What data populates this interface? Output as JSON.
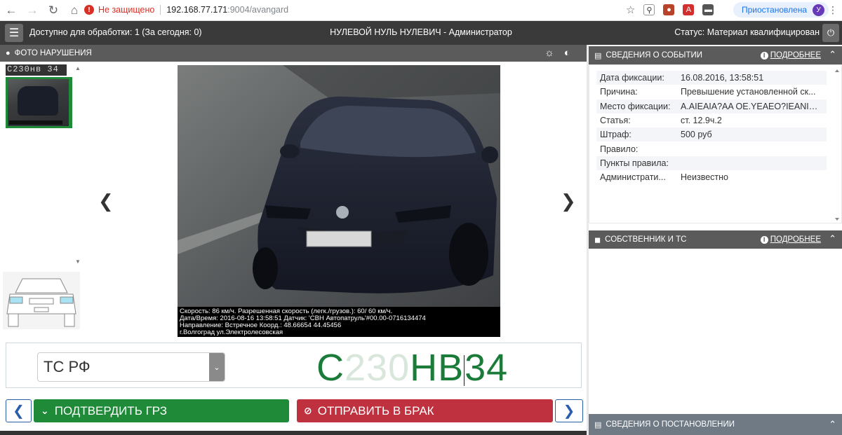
{
  "browser": {
    "insecure_label": "Не защищено",
    "url_host": "192.168.77.171",
    "url_path": ":9004/avangard",
    "profile_status": "Приостановлена",
    "profile_initial": "У"
  },
  "header": {
    "available": "Доступно для обработки: 1 (За сегодня: 0)",
    "user": "НУЛЕВОЙ НУЛЬ НУЛЕВИЧ - Администратор",
    "status": "Статус: Материал квалифицирован"
  },
  "photo_panel": {
    "title": "Фото нарушения",
    "thumb_plate": "С230нв 34",
    "info_lines": [
      "Скорость:  86 км/ч. Разрешенная скорость (легк./грузов.):  60/ 60 км/ч.",
      "Дата/Время: 2016-08-16 13:58:51 Датчик: 'СВН Автопатруль'#00.00-0716134474",
      "Направление: Встречное Коорд.: 48.66654 44.45456",
      "г.Волгоград ул.Электролесовская"
    ],
    "plate_on_car": "С230нв 34"
  },
  "plate_input": {
    "country": "ТС РФ",
    "plate_prefix": "С",
    "plate_hidden": "230",
    "plate_mid": "НВ",
    "plate_region": "34"
  },
  "actions": {
    "confirm": "Подтвердить ГРЗ",
    "reject": "Отправить в брак"
  },
  "event_panel": {
    "title": "Сведения о событии",
    "more": "Подробнее",
    "rows": [
      {
        "k": "Дата фиксации:",
        "v": "16.08.2016, 13:58:51"
      },
      {
        "k": "Причина:",
        "v": "Превышение установленной ск..."
      },
      {
        "k": "Место фиксации:",
        "v": "А.AIEAIA?AA OE.YEAEO?IEANIANE..."
      },
      {
        "k": "Статья:",
        "v": "ст. 12.9ч.2"
      },
      {
        "k": "Штраф:",
        "v": "500 руб"
      },
      {
        "k": "Правило:",
        "v": ""
      },
      {
        "k": "Пункты правила:",
        "v": ""
      },
      {
        "k": "Администрати...",
        "v": "Неизвестно"
      }
    ]
  },
  "owner_panel": {
    "title": "Собственник и ТС",
    "more": "Подробнее"
  },
  "ruling_panel": {
    "title": "Сведения о постановлении"
  },
  "colors": {
    "confirm": "#1f8a38",
    "reject": "#c0313f",
    "panel_header": "#5b5b5b",
    "plate_text": "#1b7c3a"
  }
}
